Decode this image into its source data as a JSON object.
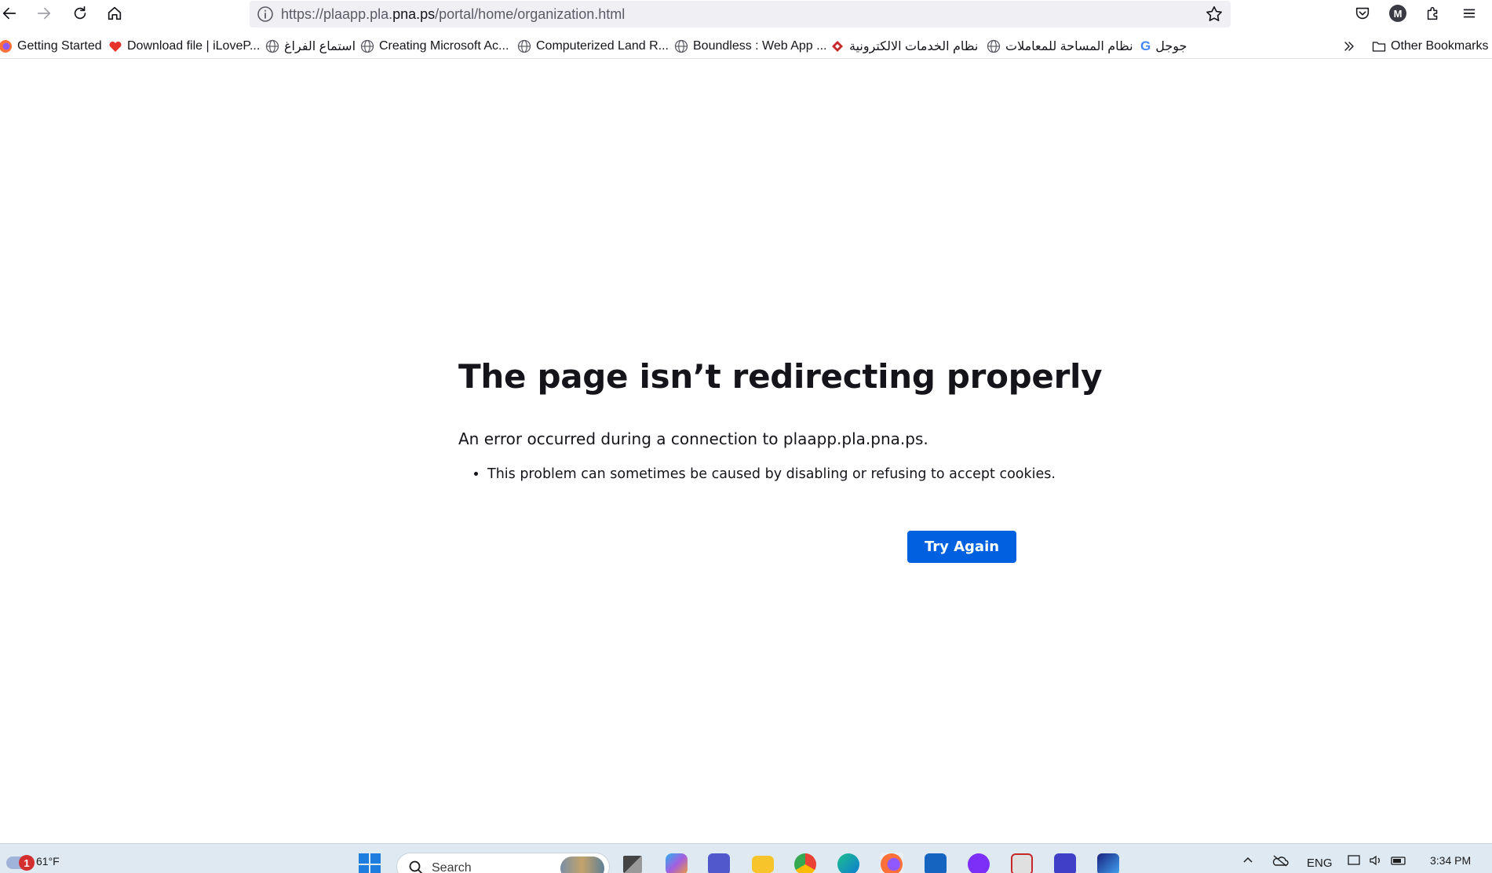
{
  "browser": {
    "url": {
      "prefix": "https://plaapp.pla.",
      "host": "pna.ps",
      "suffix": "/portal/home/organization.html"
    },
    "profile_initial": "M",
    "bookmarks": [
      {
        "label": "Getting Started",
        "icon": "firefox-icon"
      },
      {
        "label": "Download file | iLoveP...",
        "icon": "heart-icon"
      },
      {
        "label": "استماع الفراغ",
        "icon": "globe-icon"
      },
      {
        "label": "Creating Microsoft Ac...",
        "icon": "globe-icon"
      },
      {
        "label": "Computerized Land R...",
        "icon": "globe-icon"
      },
      {
        "label": "Boundless : Web App ...",
        "icon": "globe-icon"
      },
      {
        "label": "نظام الخدمات الالكترونية",
        "icon": "site-logo-icon"
      },
      {
        "label": "نظام المساحة للمعاملات",
        "icon": "globe-icon"
      },
      {
        "label": "جوجل",
        "icon": "google-icon"
      }
    ],
    "other_bookmarks_label": "Other Bookmarks"
  },
  "error": {
    "title": "The page isn’t redirecting properly",
    "description": "An error occurred during a connection to plaapp.pla.pna.ps.",
    "reasons": [
      "This problem can sometimes be caused by disabling or refusing to accept cookies."
    ],
    "button_label": "Try Again"
  },
  "taskbar": {
    "weather_temp": "61°F",
    "weather_badge": "1",
    "search_placeholder": "Search",
    "language": "ENG",
    "time": "3:34 PM"
  },
  "colors": {
    "accent_button": "#0061e0",
    "taskbar_bg": "#dfe9f1",
    "url_bar_bg": "#f0f0f4"
  }
}
